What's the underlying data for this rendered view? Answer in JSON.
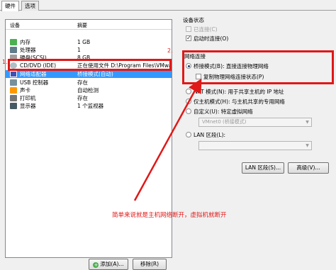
{
  "tabs": [
    {
      "label": "硬件",
      "active": true
    },
    {
      "label": "选项",
      "active": false
    }
  ],
  "device_table": {
    "headers": {
      "device": "设备",
      "summary": "摘要"
    },
    "rows": [
      {
        "name": "内存",
        "summary": "1 GB",
        "icon": "memory-icon",
        "color": "#4caf50"
      },
      {
        "name": "处理器",
        "summary": "1",
        "icon": "processor-icon",
        "color": "#607d8b"
      },
      {
        "name": "硬盘(SCSI)",
        "summary": "8 GB",
        "icon": "hard-disk-icon",
        "color": "#9e9e9e"
      },
      {
        "name": "CD/DVD (IDE)",
        "summary": "正在使用文件 D:\\Program Files\\VMware",
        "icon": "cd-dvd-icon",
        "color": "#b0bec5"
      },
      {
        "name": "网络适配器",
        "summary": "桥接模式(自动)",
        "icon": "network-adapter-icon",
        "color": "#3f51b5",
        "selected": true
      },
      {
        "name": "USB 控制器",
        "summary": "存在",
        "icon": "usb-controller-icon",
        "color": "#78909c"
      },
      {
        "name": "声卡",
        "summary": "自动检测",
        "icon": "sound-card-icon",
        "color": "#ff9800"
      },
      {
        "name": "打印机",
        "summary": "存在",
        "icon": "printer-icon",
        "color": "#757575"
      },
      {
        "name": "显示器",
        "summary": "1 个监视器",
        "icon": "display-icon",
        "color": "#455a64"
      }
    ],
    "add_button": "添加(A)...",
    "remove_button": "移除(R)"
  },
  "device_status": {
    "title": "设备状态",
    "connected": {
      "label": "已连接(C)",
      "checked": false,
      "enabled": false
    },
    "connect_on_power_on": {
      "label": "启动时连接(O)",
      "checked": true
    }
  },
  "network_connection": {
    "title": "网络连接",
    "bridged": {
      "label": "桥接模式(B): 直接连接物理网络",
      "checked": true
    },
    "replicate": {
      "label": "复制物理网络连接状态(P)",
      "checked": false
    },
    "nat": {
      "label": "NAT 模式(N): 用于共享主机的 IP 地址",
      "checked": false
    },
    "host_only": {
      "label": "仅主机模式(H): 与主机共享的专用网络",
      "checked": false
    },
    "custom": {
      "label": "自定义(U): 特定虚拟网络",
      "checked": false
    },
    "custom_select": "VMnet0 (桥接模式)",
    "lan_segment": {
      "label": "LAN 区段(L):",
      "checked": false
    },
    "lan_select": "",
    "lan_segments_button": "LAN 区段(S)...",
    "advanced_button": "高级(V)..."
  },
  "annotations": {
    "marker_1": "1.",
    "marker_2": "2.",
    "note": "简单来说就是主机网络断开，虚拟机就断开",
    "color": "#e01818"
  }
}
